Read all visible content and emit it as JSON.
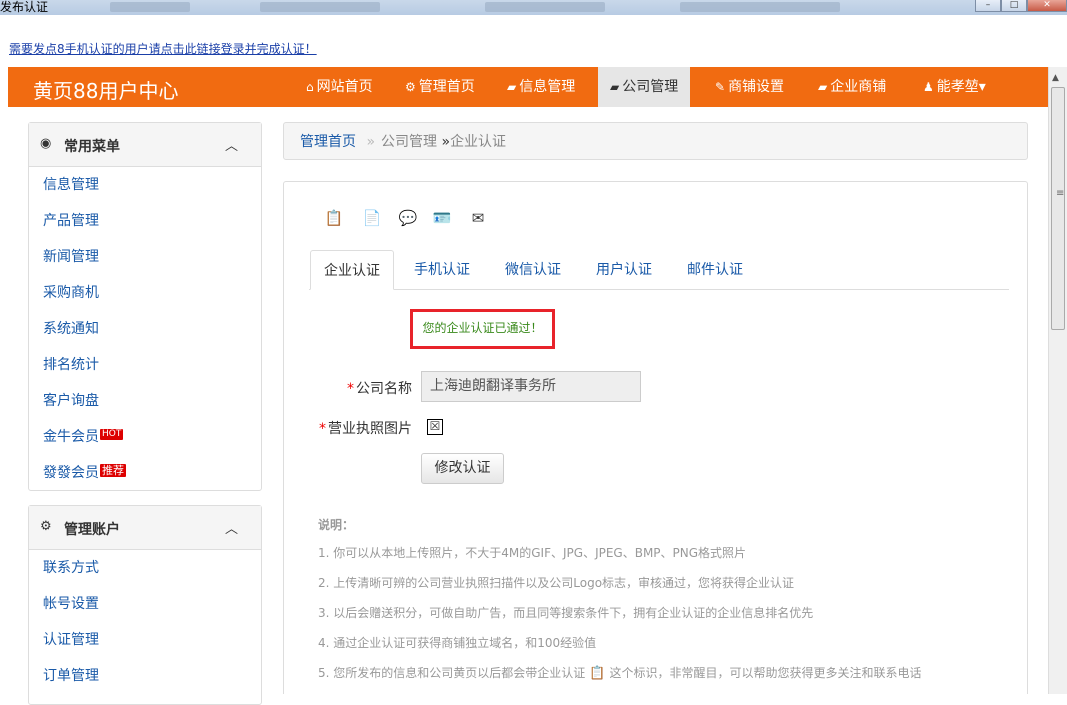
{
  "window": {
    "title": "发布认证",
    "min": "–",
    "max": "□",
    "close": "✕"
  },
  "notice": "需要发点8手机认证的用户请点击此链接登录并完成认证！",
  "header": {
    "brand": "黄页88用户中心",
    "nav": [
      {
        "icon": "⌂",
        "label": "网站首页"
      },
      {
        "icon": "⚙",
        "label": "管理首页"
      },
      {
        "icon": "▰",
        "label": "信息管理"
      },
      {
        "icon": "▰",
        "label": "公司管理"
      },
      {
        "icon": "✎",
        "label": "商铺设置"
      },
      {
        "icon": "▰",
        "label": "企业商铺"
      },
      {
        "icon": "♟",
        "label": "能孝堃",
        "caret": "▾"
      }
    ],
    "active_index": 3
  },
  "sidebar": {
    "panel1": {
      "icon": "◉",
      "title": "常用菜单",
      "chevron": "︿",
      "items": [
        "信息管理",
        "产品管理",
        "新闻管理",
        "采购商机",
        "系统通知",
        "排名统计",
        "客户询盘",
        "金牛会员",
        "發發会员"
      ],
      "badge_hot": "HOT",
      "badge_rec": "推荐"
    },
    "panel2": {
      "icon": "⚙",
      "title": "管理账户",
      "chevron": "︿",
      "items": [
        "联系方式",
        "帐号设置",
        "认证管理",
        "订单管理"
      ]
    }
  },
  "breadcrumb": {
    "home": "管理首页",
    "sep1": "»",
    "section": "公司管理",
    "sep2": "»",
    "current": "企业认证"
  },
  "cert": {
    "icons": [
      "📋",
      "📄",
      "💬",
      "🪪",
      "✉"
    ],
    "tabs": [
      "企业认证",
      "手机认证",
      "微信认证",
      "用户认证",
      "邮件认证"
    ],
    "active_tab": 0,
    "status": "您的企业认证已通过！",
    "company_label": "公司名称",
    "company_value": "上海迪朗翻译事务所",
    "license_label": "营业执照图片",
    "license_glyph": "☒",
    "edit_button": "修改认证",
    "notes_title": "说明：",
    "notes": [
      "1. 你可以从本地上传照片，不大于4M的GIF、JPG、JPEG、BMP、PNG格式照片",
      "2. 上传清晰可辨的公司营业执照扫描件以及公司Logo标志，审核通过，您将获得企业认证",
      "3. 以后会赠送积分，可做自助广告，而且同等搜索条件下，拥有企业认证的企业信息排名优先",
      "4. 通过企业认证可获得商铺独立域名，和100经验值"
    ],
    "note5_a": "5. 您所发布的信息和公司黄页以后都会带企业认证",
    "note5_icon": "📋",
    "note5_b": "这个标识，非常醒目，可以帮助您获得更多关注和联系电话"
  },
  "colors": {
    "brand_orange": "#f16b11",
    "link_blue": "#1a5aa8",
    "alert_red": "#e8232a",
    "success_green": "#3a8a1c"
  }
}
